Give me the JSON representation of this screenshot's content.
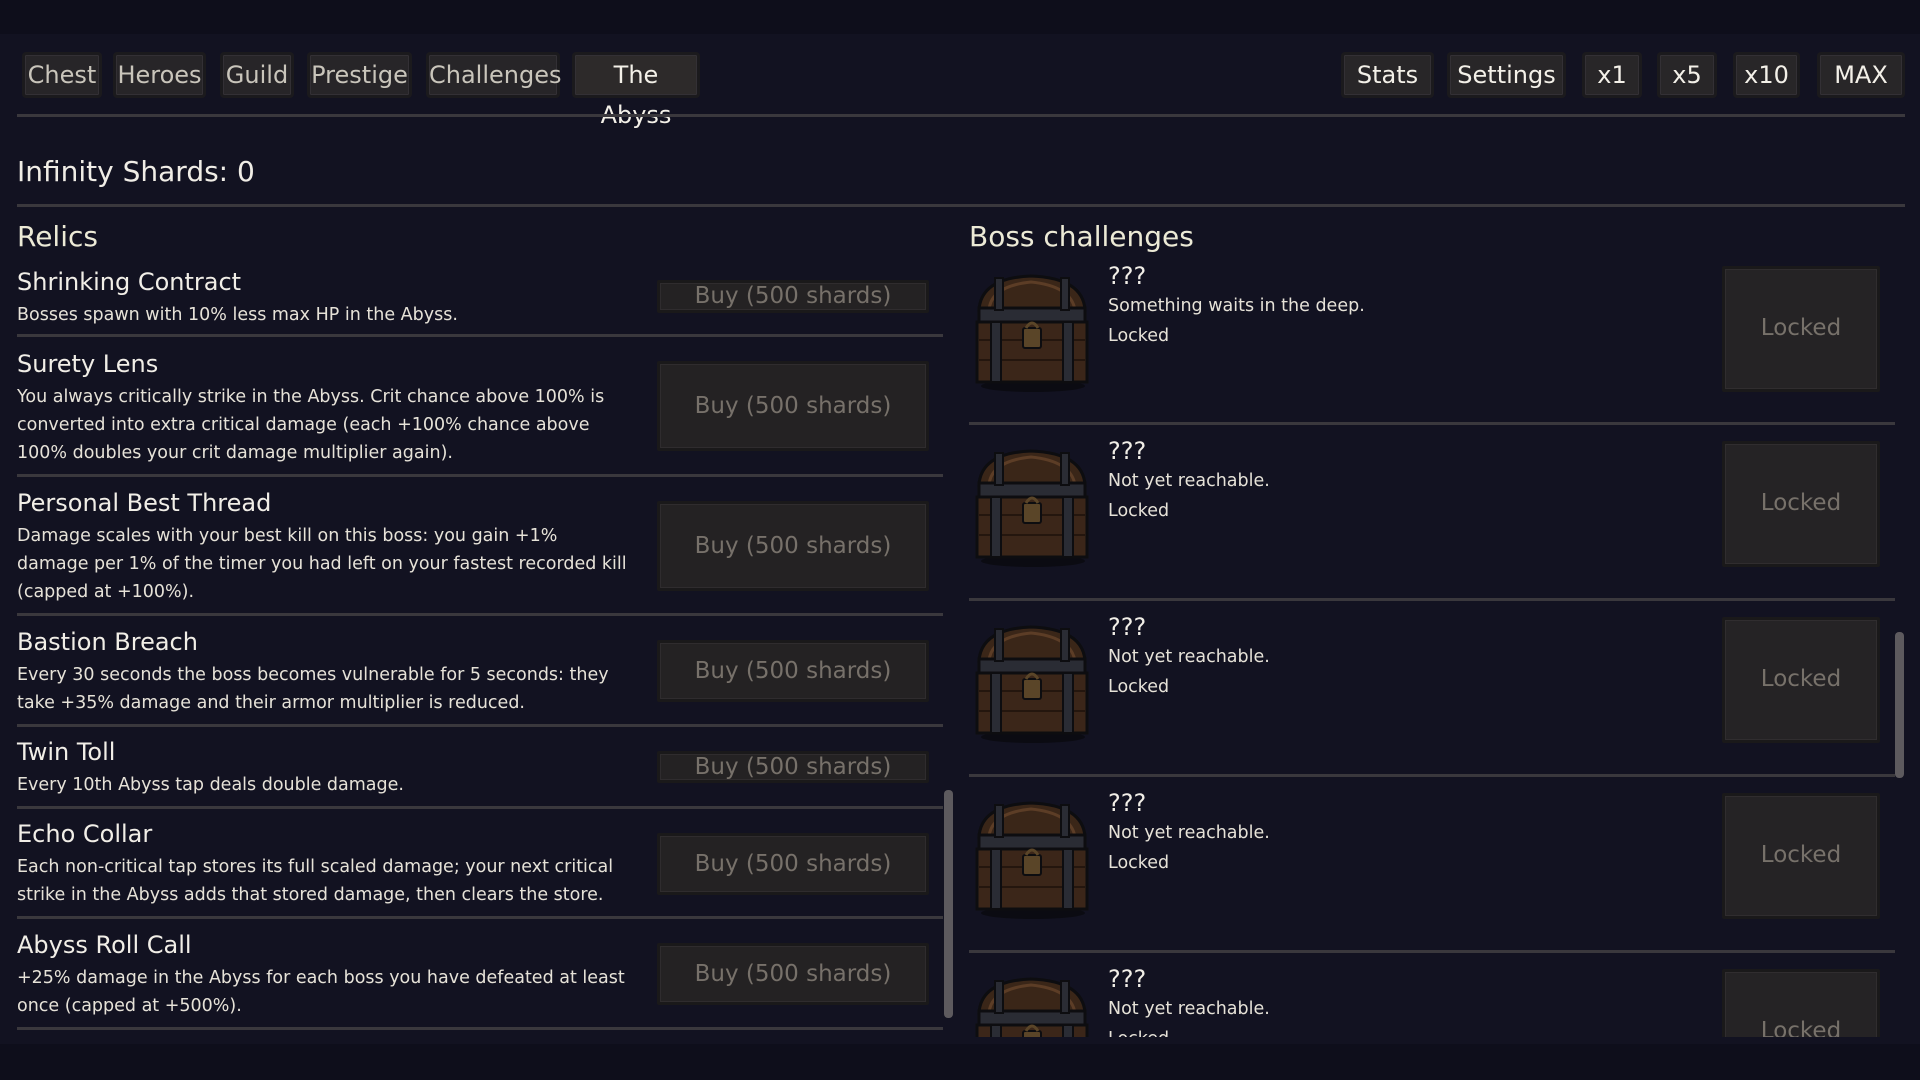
{
  "tabs": [
    {
      "label": "Chest"
    },
    {
      "label": "Heroes"
    },
    {
      "label": "Guild"
    },
    {
      "label": "Prestige"
    },
    {
      "label": "Challenges"
    },
    {
      "label": "The Abyss",
      "active": true
    }
  ],
  "toolbar": {
    "stats": "Stats",
    "settings": "Settings",
    "x1": "x1",
    "x5": "x5",
    "x10": "x10",
    "max": "MAX"
  },
  "shards": {
    "label": "Infinity Shards: 0"
  },
  "relics": {
    "title": "Relics",
    "items": [
      {
        "name": "Shrinking Contract",
        "desc": "Bosses spawn with 10% less max HP in the Abyss.",
        "buy": "Buy (500 shards)"
      },
      {
        "name": "Surety Lens",
        "desc": "You always critically strike in the Abyss. Crit chance above 100% is converted into extra critical damage (each +100% chance above 100% doubles your crit damage multiplier again).",
        "buy": "Buy (500 shards)"
      },
      {
        "name": "Personal Best Thread",
        "desc": "Damage scales with your best kill on this boss: you gain +1% damage per 1% of the timer you had left on your fastest recorded kill (capped at +100%).",
        "buy": "Buy (500 shards)"
      },
      {
        "name": "Bastion Breach",
        "desc": "Every 30 seconds the boss becomes vulnerable for 5 seconds: they take +35% damage and their armor multiplier is reduced.",
        "buy": "Buy (500 shards)"
      },
      {
        "name": "Twin Toll",
        "desc": "Every 10th Abyss tap deals double damage.",
        "buy": "Buy (500 shards)"
      },
      {
        "name": "Echo Collar",
        "desc": "Each non-critical tap stores its full scaled damage; your next critical strike in the Abyss adds that stored damage, then clears the store.",
        "buy": "Buy (500 shards)"
      },
      {
        "name": "Abyss Roll Call",
        "desc": "+25% damage in the Abyss for each boss you have defeated at least once (capped at +500%).",
        "buy": "Buy (500 shards)"
      }
    ]
  },
  "bosses": {
    "title": "Boss challenges",
    "items": [
      {
        "name": "???",
        "desc": "Something waits in the deep.",
        "status": "Locked",
        "button": "Locked"
      },
      {
        "name": "???",
        "desc": "Not yet reachable.",
        "status": "Locked",
        "button": "Locked"
      },
      {
        "name": "???",
        "desc": "Not yet reachable.",
        "status": "Locked",
        "button": "Locked"
      },
      {
        "name": "???",
        "desc": "Not yet reachable.",
        "status": "Locked",
        "button": "Locked"
      },
      {
        "name": "???",
        "desc": "Not yet reachable.",
        "status": "Locked",
        "button": "Locked"
      }
    ]
  },
  "colors": {
    "background": "#121221",
    "panel": "#272528",
    "text": "#e9e6dc",
    "disabled_text": "#77716a"
  }
}
